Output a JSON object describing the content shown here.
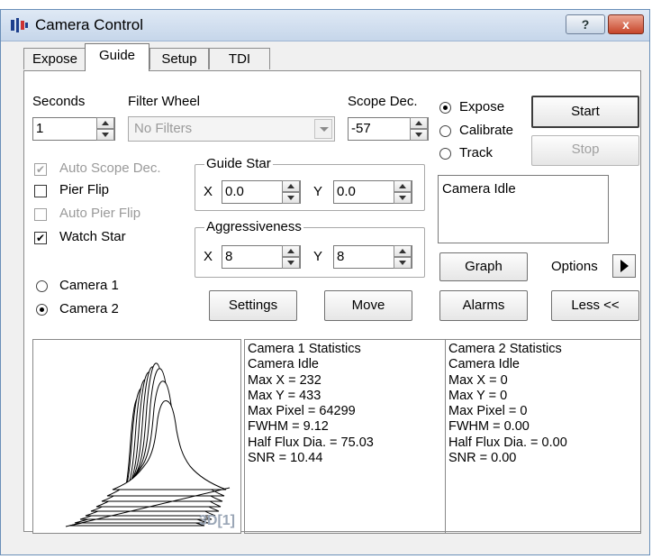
{
  "window": {
    "title": "Camera Control"
  },
  "titlebar": {
    "help_label": "?",
    "close_label": "x"
  },
  "tabs": [
    {
      "label": "Expose",
      "active": false
    },
    {
      "label": "Guide",
      "active": true
    },
    {
      "label": "Setup",
      "active": false
    },
    {
      "label": "TDI",
      "active": false
    }
  ],
  "guide": {
    "seconds": {
      "label": "Seconds",
      "value": "1"
    },
    "filter_wheel": {
      "label": "Filter Wheel",
      "value": "No Filters"
    },
    "scope_dec": {
      "label": "Scope Dec.",
      "value": "-57"
    },
    "mode_radios": [
      {
        "label": "Expose",
        "checked": true
      },
      {
        "label": "Calibrate",
        "checked": false
      },
      {
        "label": "Track",
        "checked": false
      }
    ],
    "start_label": "Start",
    "stop_label": "Stop",
    "checkboxes": [
      {
        "label": "Auto Scope Dec.",
        "checked": true,
        "enabled": false
      },
      {
        "label": "Pier Flip",
        "checked": false,
        "enabled": true
      },
      {
        "label": "Auto Pier Flip",
        "checked": false,
        "enabled": false
      },
      {
        "label": "Watch Star",
        "checked": true,
        "enabled": true
      }
    ],
    "guide_star": {
      "title": "Guide Star",
      "x_label": "X",
      "x_value": "0.0",
      "y_label": "Y",
      "y_value": "0.0"
    },
    "aggressiveness": {
      "title": "Aggressiveness",
      "x_label": "X",
      "x_value": "8",
      "y_label": "Y",
      "y_value": "8"
    },
    "status_text": "Camera Idle",
    "graph_label": "Graph",
    "options_label": "Options",
    "camera_radios": [
      {
        "label": "Camera 1",
        "checked": false
      },
      {
        "label": "Camera 2",
        "checked": true
      }
    ],
    "settings_label": "Settings",
    "move_label": "Move",
    "alarms_label": "Alarms",
    "less_label": "Less <<",
    "plot_label": "3D[1]"
  },
  "stats": {
    "camera1": [
      "Camera 1 Statistics",
      "Camera Idle",
      "Max X = 232",
      "Max Y = 433",
      "Max Pixel = 64299",
      "FWHM = 9.12",
      "Half Flux Dia. = 75.03",
      "SNR = 10.44"
    ],
    "camera2": [
      "Camera 2 Statistics",
      "Camera Idle",
      "Max X = 0",
      "Max Y = 0",
      "Max Pixel = 0",
      "FWHM = 0.00",
      "Half Flux Dia. = 0.00",
      "SNR = 0.00"
    ]
  },
  "colors": {
    "title_gradient_top": "#dfe9f5",
    "close_button": "#c6452a",
    "disabled_text": "#9a9a9a"
  }
}
